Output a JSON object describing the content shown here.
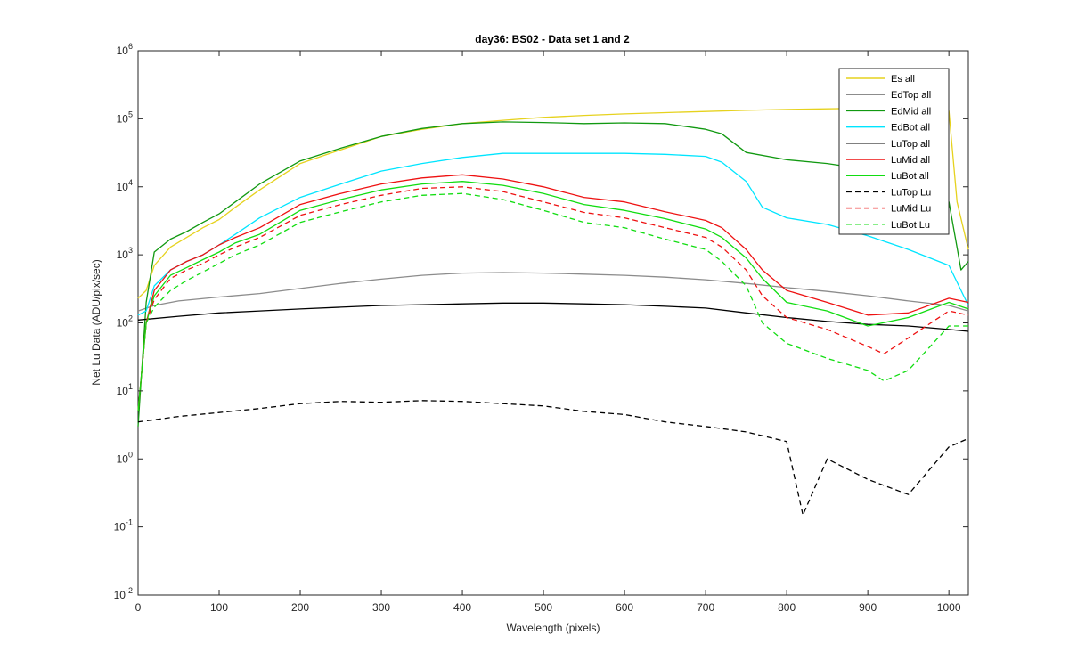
{
  "chart_data": {
    "type": "line",
    "title": "day36: BS02 - Data set 1 and 2",
    "xlabel": "Wavelength (pixels)",
    "ylabel": "Net Lu Data (ADU/pix/sec)",
    "xlim": [
      0,
      1024
    ],
    "ylim": [
      0.01,
      1000000
    ],
    "yscale": "log",
    "x_ticks": [
      0,
      100,
      200,
      300,
      400,
      500,
      600,
      700,
      800,
      900,
      1000
    ],
    "y_ticks": [
      {
        "base": "10",
        "exp": "-2",
        "value": 0.01
      },
      {
        "base": "10",
        "exp": "-1",
        "value": 0.1
      },
      {
        "base": "10",
        "exp": "0",
        "value": 1
      },
      {
        "base": "10",
        "exp": "1",
        "value": 10
      },
      {
        "base": "10",
        "exp": "2",
        "value": 100
      },
      {
        "base": "10",
        "exp": "3",
        "value": 1000
      },
      {
        "base": "10",
        "exp": "4",
        "value": 10000
      },
      {
        "base": "10",
        "exp": "5",
        "value": 100000
      },
      {
        "base": "10",
        "exp": "6",
        "value": 1000000
      }
    ],
    "grid": false,
    "legend_position": "top-right",
    "series": [
      {
        "name": "Es  all",
        "color": "#e6d21e",
        "dash": "solid",
        "points": [
          [
            0,
            230
          ],
          [
            10,
            300
          ],
          [
            20,
            700
          ],
          [
            40,
            1300
          ],
          [
            60,
            1800
          ],
          [
            80,
            2500
          ],
          [
            100,
            3300
          ],
          [
            120,
            5000
          ],
          [
            150,
            9000
          ],
          [
            200,
            22000
          ],
          [
            250,
            35000
          ],
          [
            300,
            55000
          ],
          [
            350,
            70000
          ],
          [
            400,
            85000
          ],
          [
            450,
            95000
          ],
          [
            500,
            105000
          ],
          [
            550,
            112000
          ],
          [
            600,
            118000
          ],
          [
            650,
            123000
          ],
          [
            700,
            128000
          ],
          [
            750,
            133000
          ],
          [
            800,
            137000
          ],
          [
            850,
            140000
          ],
          [
            900,
            143000
          ],
          [
            950,
            147000
          ],
          [
            1000,
            130000
          ],
          [
            1010,
            6000
          ],
          [
            1024,
            1200
          ]
        ]
      },
      {
        "name": "EdTop  all",
        "color": "#8c8c8c",
        "dash": "solid",
        "points": [
          [
            0,
            150
          ],
          [
            20,
            180
          ],
          [
            50,
            210
          ],
          [
            100,
            240
          ],
          [
            150,
            270
          ],
          [
            200,
            320
          ],
          [
            250,
            380
          ],
          [
            300,
            440
          ],
          [
            350,
            500
          ],
          [
            400,
            540
          ],
          [
            450,
            550
          ],
          [
            500,
            540
          ],
          [
            550,
            520
          ],
          [
            600,
            500
          ],
          [
            650,
            470
          ],
          [
            700,
            430
          ],
          [
            750,
            380
          ],
          [
            800,
            330
          ],
          [
            850,
            290
          ],
          [
            900,
            250
          ],
          [
            950,
            210
          ],
          [
            1000,
            180
          ],
          [
            1024,
            150
          ]
        ]
      },
      {
        "name": "EdMid  all",
        "color": "#119911",
        "dash": "solid",
        "points": [
          [
            0,
            3
          ],
          [
            10,
            200
          ],
          [
            20,
            1100
          ],
          [
            40,
            1700
          ],
          [
            60,
            2200
          ],
          [
            80,
            3000
          ],
          [
            100,
            4000
          ],
          [
            120,
            6000
          ],
          [
            150,
            11000
          ],
          [
            200,
            24000
          ],
          [
            250,
            37000
          ],
          [
            300,
            55000
          ],
          [
            350,
            72000
          ],
          [
            400,
            85000
          ],
          [
            450,
            90000
          ],
          [
            500,
            88000
          ],
          [
            550,
            85000
          ],
          [
            600,
            87000
          ],
          [
            650,
            85000
          ],
          [
            700,
            70000
          ],
          [
            720,
            60000
          ],
          [
            750,
            32000
          ],
          [
            800,
            25000
          ],
          [
            850,
            22000
          ],
          [
            900,
            18000
          ],
          [
            950,
            14000
          ],
          [
            1000,
            6000
          ],
          [
            1015,
            600
          ],
          [
            1024,
            800
          ]
        ]
      },
      {
        "name": "EdBot  all",
        "color": "#00e5ff",
        "dash": "solid",
        "points": [
          [
            0,
            130
          ],
          [
            10,
            150
          ],
          [
            20,
            350
          ],
          [
            40,
            600
          ],
          [
            60,
            800
          ],
          [
            80,
            1000
          ],
          [
            100,
            1400
          ],
          [
            120,
            2000
          ],
          [
            150,
            3500
          ],
          [
            200,
            7000
          ],
          [
            250,
            11000
          ],
          [
            300,
            17000
          ],
          [
            350,
            22000
          ],
          [
            400,
            27000
          ],
          [
            450,
            31000
          ],
          [
            500,
            31000
          ],
          [
            550,
            31000
          ],
          [
            600,
            31000
          ],
          [
            650,
            30000
          ],
          [
            700,
            28000
          ],
          [
            720,
            23000
          ],
          [
            750,
            12000
          ],
          [
            770,
            5000
          ],
          [
            800,
            3500
          ],
          [
            850,
            2800
          ],
          [
            900,
            1900
          ],
          [
            950,
            1200
          ],
          [
            1000,
            700
          ],
          [
            1024,
            180
          ]
        ]
      },
      {
        "name": "LuTop  all",
        "color": "#000000",
        "dash": "solid",
        "points": [
          [
            0,
            110
          ],
          [
            50,
            125
          ],
          [
            100,
            140
          ],
          [
            150,
            150
          ],
          [
            200,
            160
          ],
          [
            250,
            170
          ],
          [
            300,
            180
          ],
          [
            350,
            185
          ],
          [
            400,
            190
          ],
          [
            450,
            195
          ],
          [
            500,
            195
          ],
          [
            550,
            190
          ],
          [
            600,
            185
          ],
          [
            650,
            175
          ],
          [
            700,
            165
          ],
          [
            750,
            140
          ],
          [
            800,
            120
          ],
          [
            850,
            105
          ],
          [
            900,
            95
          ],
          [
            950,
            90
          ],
          [
            1000,
            80
          ],
          [
            1024,
            75
          ]
        ]
      },
      {
        "name": "LuMid  all",
        "color": "#ee1111",
        "dash": "solid",
        "points": [
          [
            0,
            5
          ],
          [
            10,
            100
          ],
          [
            20,
            300
          ],
          [
            40,
            600
          ],
          [
            60,
            800
          ],
          [
            80,
            1000
          ],
          [
            100,
            1400
          ],
          [
            120,
            1800
          ],
          [
            150,
            2500
          ],
          [
            200,
            5500
          ],
          [
            250,
            8000
          ],
          [
            300,
            11000
          ],
          [
            350,
            13500
          ],
          [
            400,
            15000
          ],
          [
            450,
            13000
          ],
          [
            500,
            10000
          ],
          [
            550,
            7000
          ],
          [
            600,
            6000
          ],
          [
            650,
            4300
          ],
          [
            700,
            3200
          ],
          [
            720,
            2500
          ],
          [
            750,
            1200
          ],
          [
            770,
            600
          ],
          [
            800,
            300
          ],
          [
            850,
            200
          ],
          [
            900,
            130
          ],
          [
            950,
            140
          ],
          [
            1000,
            230
          ],
          [
            1024,
            200
          ]
        ]
      },
      {
        "name": "LuBot  all",
        "color": "#11dd11",
        "dash": "solid",
        "points": [
          [
            0,
            5
          ],
          [
            10,
            100
          ],
          [
            20,
            250
          ],
          [
            40,
            500
          ],
          [
            60,
            650
          ],
          [
            80,
            850
          ],
          [
            100,
            1100
          ],
          [
            120,
            1500
          ],
          [
            150,
            2000
          ],
          [
            200,
            4500
          ],
          [
            250,
            6500
          ],
          [
            300,
            9000
          ],
          [
            350,
            11000
          ],
          [
            400,
            12000
          ],
          [
            450,
            10500
          ],
          [
            500,
            8000
          ],
          [
            550,
            5500
          ],
          [
            600,
            4500
          ],
          [
            650,
            3400
          ],
          [
            700,
            2400
          ],
          [
            720,
            1800
          ],
          [
            750,
            900
          ],
          [
            770,
            450
          ],
          [
            800,
            200
          ],
          [
            850,
            150
          ],
          [
            900,
            90
          ],
          [
            950,
            120
          ],
          [
            1000,
            200
          ],
          [
            1024,
            160
          ]
        ]
      },
      {
        "name": "LuTop  Lu",
        "color": "#000000",
        "dash": "dashed",
        "points": [
          [
            0,
            3.5
          ],
          [
            50,
            4.2
          ],
          [
            100,
            4.8
          ],
          [
            150,
            5.5
          ],
          [
            200,
            6.5
          ],
          [
            250,
            7
          ],
          [
            300,
            6.8
          ],
          [
            350,
            7.2
          ],
          [
            400,
            7
          ],
          [
            450,
            6.5
          ],
          [
            500,
            6
          ],
          [
            550,
            5
          ],
          [
            600,
            4.5
          ],
          [
            650,
            3.5
          ],
          [
            700,
            3
          ],
          [
            750,
            2.5
          ],
          [
            800,
            1.8
          ],
          [
            820,
            0.15
          ],
          [
            850,
            1
          ],
          [
            900,
            0.5
          ],
          [
            950,
            0.3
          ],
          [
            1000,
            1.5
          ],
          [
            1024,
            2
          ]
        ]
      },
      {
        "name": "LuMid  Lu",
        "color": "#ee1111",
        "dash": "dashed",
        "points": [
          [
            0,
            5
          ],
          [
            10,
            100
          ],
          [
            20,
            220
          ],
          [
            40,
            450
          ],
          [
            60,
            600
          ],
          [
            80,
            750
          ],
          [
            100,
            1000
          ],
          [
            120,
            1300
          ],
          [
            150,
            1800
          ],
          [
            200,
            3800
          ],
          [
            250,
            5500
          ],
          [
            300,
            7500
          ],
          [
            350,
            9500
          ],
          [
            400,
            10000
          ],
          [
            450,
            8500
          ],
          [
            500,
            6000
          ],
          [
            550,
            4200
          ],
          [
            600,
            3500
          ],
          [
            650,
            2500
          ],
          [
            700,
            1800
          ],
          [
            720,
            1300
          ],
          [
            750,
            600
          ],
          [
            770,
            250
          ],
          [
            800,
            120
          ],
          [
            850,
            80
          ],
          [
            900,
            45
          ],
          [
            920,
            35
          ],
          [
            950,
            60
          ],
          [
            1000,
            150
          ],
          [
            1024,
            130
          ]
        ]
      },
      {
        "name": "LuBot  Lu",
        "color": "#11dd11",
        "dash": "dashed",
        "points": [
          [
            0,
            5
          ],
          [
            10,
            100
          ],
          [
            20,
            170
          ],
          [
            40,
            300
          ],
          [
            60,
            420
          ],
          [
            80,
            560
          ],
          [
            100,
            750
          ],
          [
            120,
            1000
          ],
          [
            150,
            1400
          ],
          [
            200,
            3000
          ],
          [
            250,
            4300
          ],
          [
            300,
            6000
          ],
          [
            350,
            7500
          ],
          [
            400,
            8000
          ],
          [
            450,
            6500
          ],
          [
            500,
            4500
          ],
          [
            550,
            3000
          ],
          [
            600,
            2500
          ],
          [
            650,
            1700
          ],
          [
            700,
            1200
          ],
          [
            720,
            800
          ],
          [
            750,
            350
          ],
          [
            770,
            100
          ],
          [
            800,
            50
          ],
          [
            850,
            30
          ],
          [
            900,
            20
          ],
          [
            920,
            14
          ],
          [
            950,
            20
          ],
          [
            1000,
            90
          ],
          [
            1024,
            90
          ]
        ]
      }
    ]
  }
}
